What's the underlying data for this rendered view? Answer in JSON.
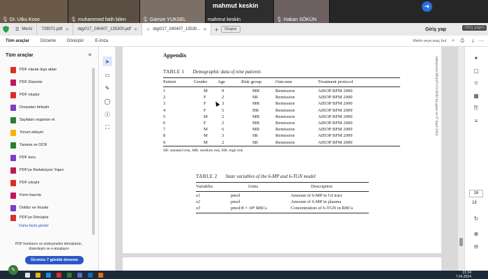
{
  "video": {
    "participants": [
      {
        "name": "Dr. Utku Kose",
        "color": "#6b5a48"
      },
      {
        "name": "muhammed fatih bilen",
        "color": "#5b4f44"
      },
      {
        "name": "Gamze YUKSEL",
        "color": "#7b6f66"
      },
      {
        "name": "mahmut keskin",
        "color": "#2e2e2e"
      },
      {
        "name": "Hakan SÖKÜN",
        "color": "#6c6060"
      }
    ],
    "speaker_banner": "mahmut keskin",
    "next_icon": "arrow-right-icon"
  },
  "browser": {
    "menu_label": "Menü",
    "tabs": [
      {
        "label": "729071.pdf"
      },
      {
        "label": "dqy017_240407_135300.pdf"
      },
      {
        "label": "dqy017_240407_13530..."
      }
    ],
    "share_label": "Oluştur",
    "login_label": "Giriş yap",
    "signin_ghost": "Giriş yapın"
  },
  "toolbar": {
    "menus": [
      "Tüm araçlar",
      "Düzenle",
      "Dönüştür",
      "E-imza"
    ],
    "search_text": "Metin veya araç bul"
  },
  "left_panel": {
    "title": "Tüm araçlar",
    "tools": [
      {
        "label": "PDF olarak dışa aktar",
        "color": "#d93025"
      },
      {
        "label": "PDF Düzenle",
        "color": "#c2185b"
      },
      {
        "label": "PDF oluştur",
        "color": "#d93025"
      },
      {
        "label": "Dosyaları birleştir",
        "color": "#7b3fc4"
      },
      {
        "label": "Sayfaları organize et",
        "color": "#2e7d32"
      },
      {
        "label": "Yorum ekleyin",
        "color": "#f4b400"
      },
      {
        "label": "Tarama ve OCR",
        "color": "#2e7d32"
      },
      {
        "label": "PDF koru",
        "color": "#7b3fc4"
      },
      {
        "label": "PDF'ye Redaksiyon Yapın",
        "color": "#c2185b"
      },
      {
        "label": "PDF sıkıştır",
        "color": "#d93025"
      },
      {
        "label": "Form hazırla",
        "color": "#c2185b"
      },
      {
        "label": "Doldur ve İmzala",
        "color": "#7b3fc4"
      },
      {
        "label": "PDF'ye Dönüştür",
        "color": "#d93025"
      }
    ],
    "more_link": "Daha fazla göster",
    "promo_text": "PDF formlarını ve sözleşmeleri dönüştürün, düzenleyin ve e-imzalayın",
    "trial_button": "Ücretsiz 7 günlük deneme"
  },
  "document": {
    "heading": "Appendix",
    "table1": {
      "number": "TABLE 1",
      "title": "Demographic data of nine patients",
      "headers": [
        "Patient",
        "Gender",
        "Age",
        "Risk group",
        "Outcome",
        "Treatment protocol"
      ],
      "rows": [
        [
          "1",
          "M",
          "9",
          "MR",
          "Remission",
          "AIEOP BFM 2000"
        ],
        [
          "2",
          "F",
          "2",
          "SR",
          "Remission",
          "AIEOP BFM 2000"
        ],
        [
          "3",
          "F",
          "3",
          "MR",
          "Remission",
          "AIEOP BFM 2000"
        ],
        [
          "4",
          "F",
          "5",
          "HR",
          "Remission",
          "AIEOP BFM 2009"
        ],
        [
          "5",
          "M",
          "2",
          "MR",
          "Remission",
          "AIEOP BFM 2000"
        ],
        [
          "6",
          "F",
          "2",
          "MR",
          "Remission",
          "AIEOP BFM 2000"
        ],
        [
          "7",
          "M",
          "6",
          "MR",
          "Remission",
          "AIEOP BFM 2009"
        ],
        [
          "8",
          "M",
          "3",
          "SR",
          "Remission",
          "AIEOP BFM 2009"
        ],
        [
          "9",
          "M",
          "2",
          "SR",
          "Remission",
          "AIEOP BFM 2000"
        ]
      ],
      "footnote": "SR: standard risk, MR: medium risk, HR: high risk"
    },
    "table2": {
      "number": "TABLE 2",
      "title": "State variables of the 6-MP and 6-TGN model",
      "headers": [
        "Variables",
        "Units",
        "Description"
      ],
      "rows": [
        [
          "x1",
          "pmol",
          "Amount of 6-MP in GI tract"
        ],
        [
          "x2",
          "pmol",
          "Amount of 6-MP in plasma"
        ],
        [
          "x3",
          "pmol/8 × 10⁸ RBCs",
          "Concentration of 6-TGN in RBCs"
        ]
      ]
    },
    "side_note": "mbt/article/38/4/471/5135050 by guest on 07 April 2024"
  },
  "pager": {
    "current": "16",
    "total": "18"
  },
  "clock": {
    "time": "21:34",
    "date": "7.04.2024"
  }
}
